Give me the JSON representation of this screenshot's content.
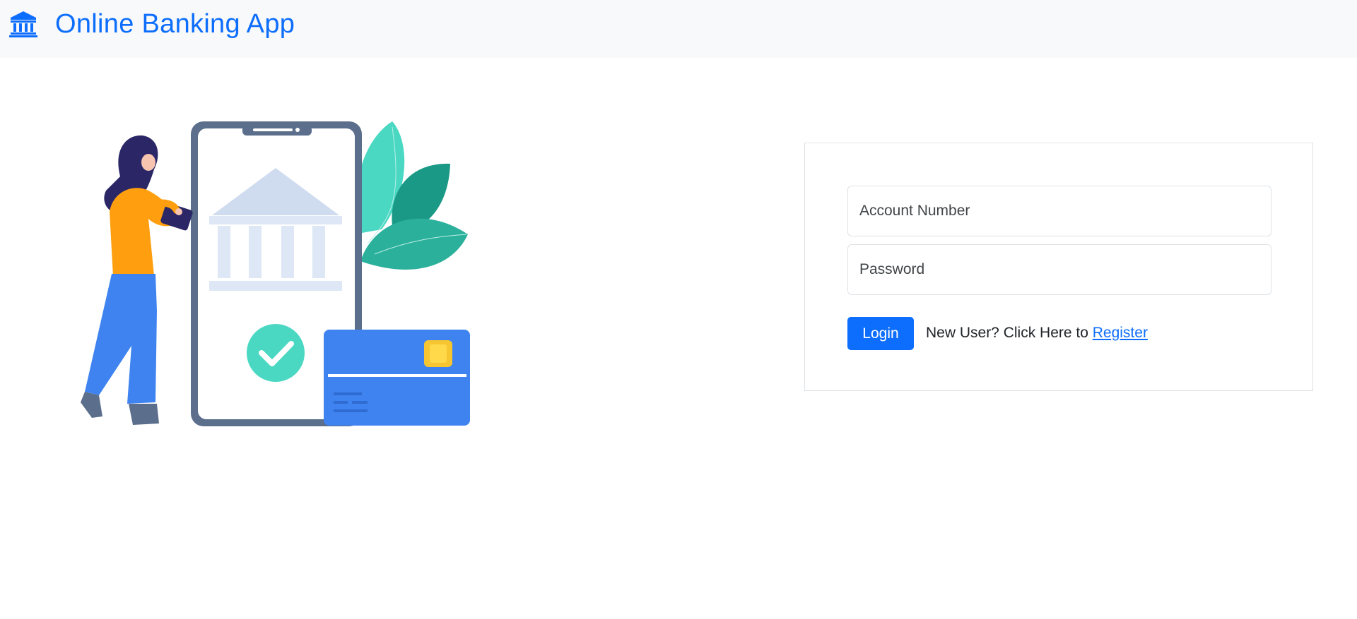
{
  "navbar": {
    "brand_icon": "bank-icon",
    "title": "Online Banking App"
  },
  "illustration": {
    "description_icons": [
      "person-with-tablet",
      "phone-with-bank",
      "checkmark-icon",
      "credit-card",
      "leaves"
    ]
  },
  "login_form": {
    "account_placeholder": "Account Number",
    "password_placeholder": "Password",
    "login_label": "Login",
    "register_prompt": "New User? Click Here to ",
    "register_link": "Register"
  },
  "colors": {
    "primary": "#0d6efd",
    "navbar_bg": "#f8f9fa",
    "border": "#dee2e6"
  }
}
